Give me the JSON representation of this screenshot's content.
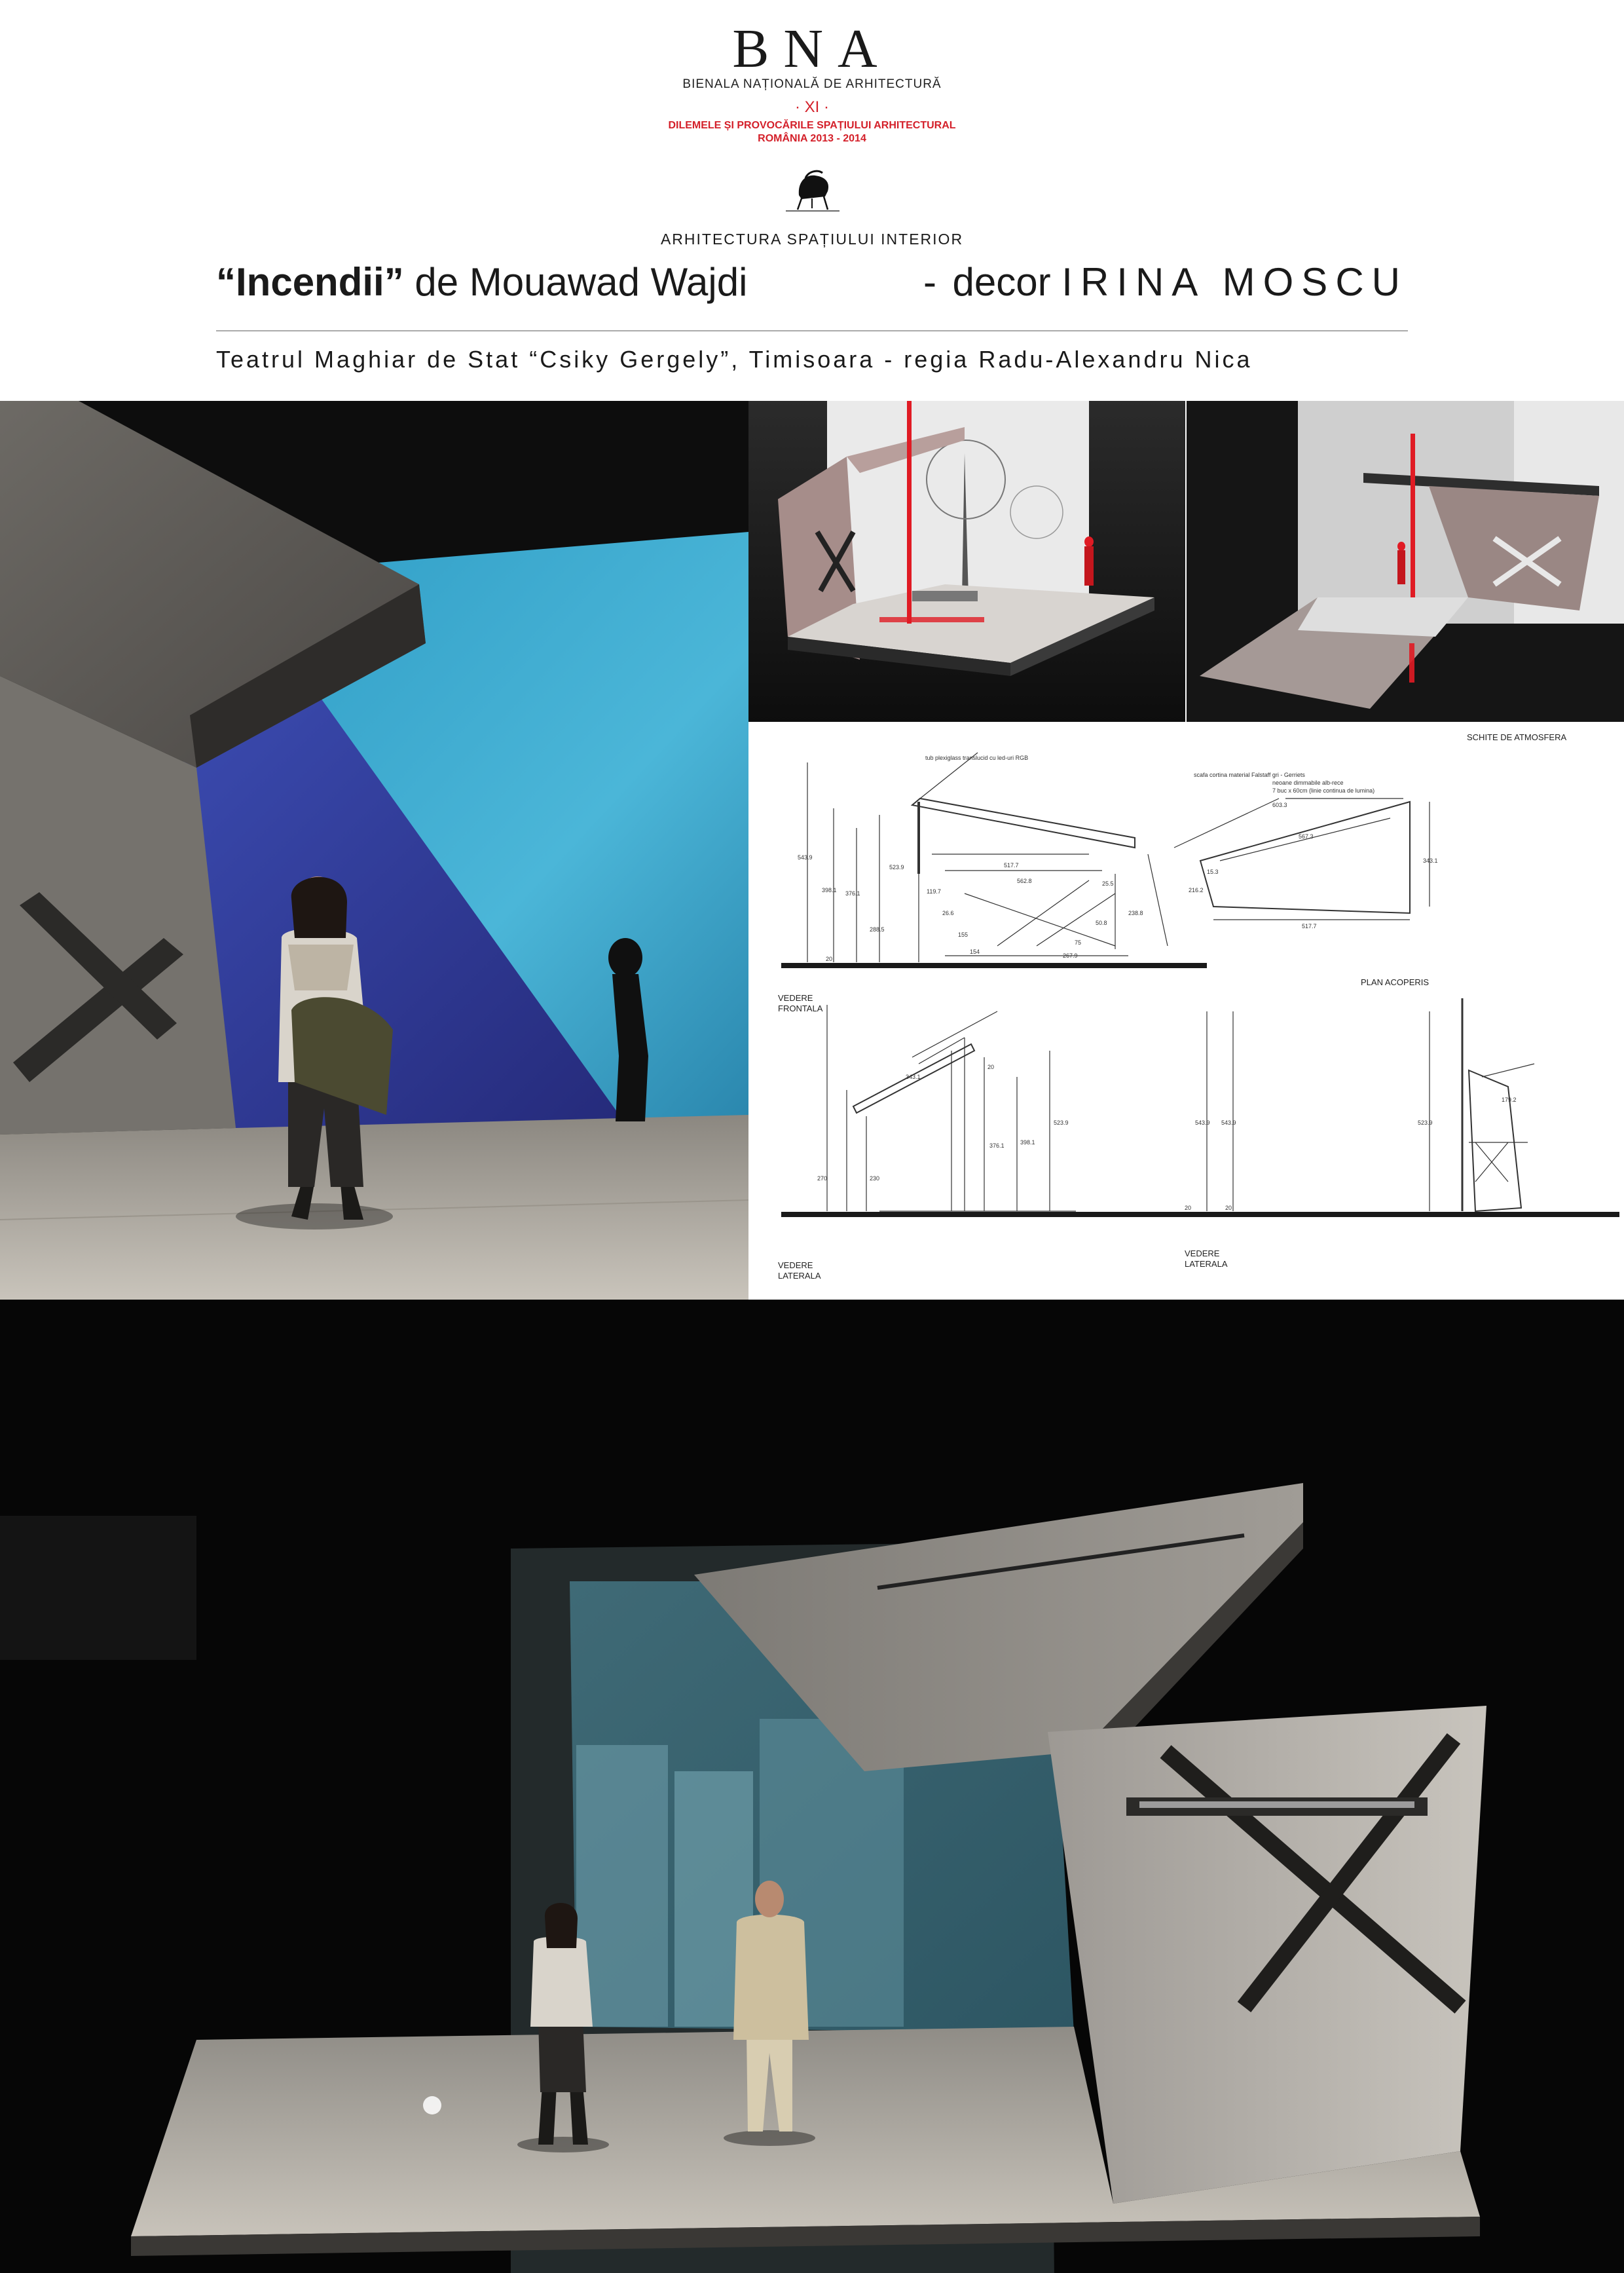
{
  "header": {
    "logo": "BNA",
    "organization": "BIENALA NAȚIONALĂ DE ARHITECTURĂ",
    "edition": "· XI ·",
    "theme": "DILEMELE ȘI PROVOCĂRILE SPAȚIULUI ARHITECTURAL",
    "years": "ROMÂNIA 2013 - 2014",
    "chair_icon": "chair-logo-icon",
    "section": "ARHITECTURA SPAȚIULUI INTERIOR",
    "title_play": "“Incendii”",
    "title_author": " de Mouawad Wajdi",
    "title_dash": "-",
    "title_decor_prefix": "decor ",
    "title_designer": "IRINA MOSCU",
    "subtitle": "Teatrul Maghiar de Stat “Csiky Gergely”, Timisoara - regia Radu-Alexandru Nica"
  },
  "drawings": {
    "heading": "SCHITE DE ATMOSFERA",
    "label_front_1": "VEDERE",
    "label_front_2": "FRONTALA",
    "label_plan": "PLAN ACOPERIS",
    "label_side_a_1": "VEDERE",
    "label_side_a_2": "LATERALA",
    "label_side_b_1": "VEDERE",
    "label_side_b_2": "LATERALA",
    "note_tube": "tub plexiglass translucid cu  led-uri RGB",
    "note_curtain": "scafa cortina material Falstaff gri - Gerriets",
    "note_neon_1": "neoane dimmabile alb-rece",
    "note_neon_2": "7 buc x 60cm (linie continua de lumina)",
    "dims_front": [
      "543.9",
      "398.1",
      "376.1",
      "523.9",
      "288.5",
      "119.7",
      "517.7",
      "562.8",
      "25.5",
      "238.8",
      "75",
      "154",
      "267.9",
      "20",
      "26.6",
      "155",
      "50.8"
    ],
    "dims_plan": [
      "603.3",
      "567.3",
      "15.3",
      "216.2",
      "343.1",
      "517.7"
    ],
    "dims_side_a": [
      "343.1",
      "20",
      "270",
      "230",
      "376.1",
      "398.1",
      "523.9"
    ],
    "dims_side_b": [
      "543.9",
      "543.9",
      "20",
      "20",
      "523.9",
      "179.2"
    ]
  },
  "colors": {
    "accent_red": "#d4202a",
    "text_dark": "#1a1a1a",
    "projection_blue": "#3ba9cf"
  }
}
